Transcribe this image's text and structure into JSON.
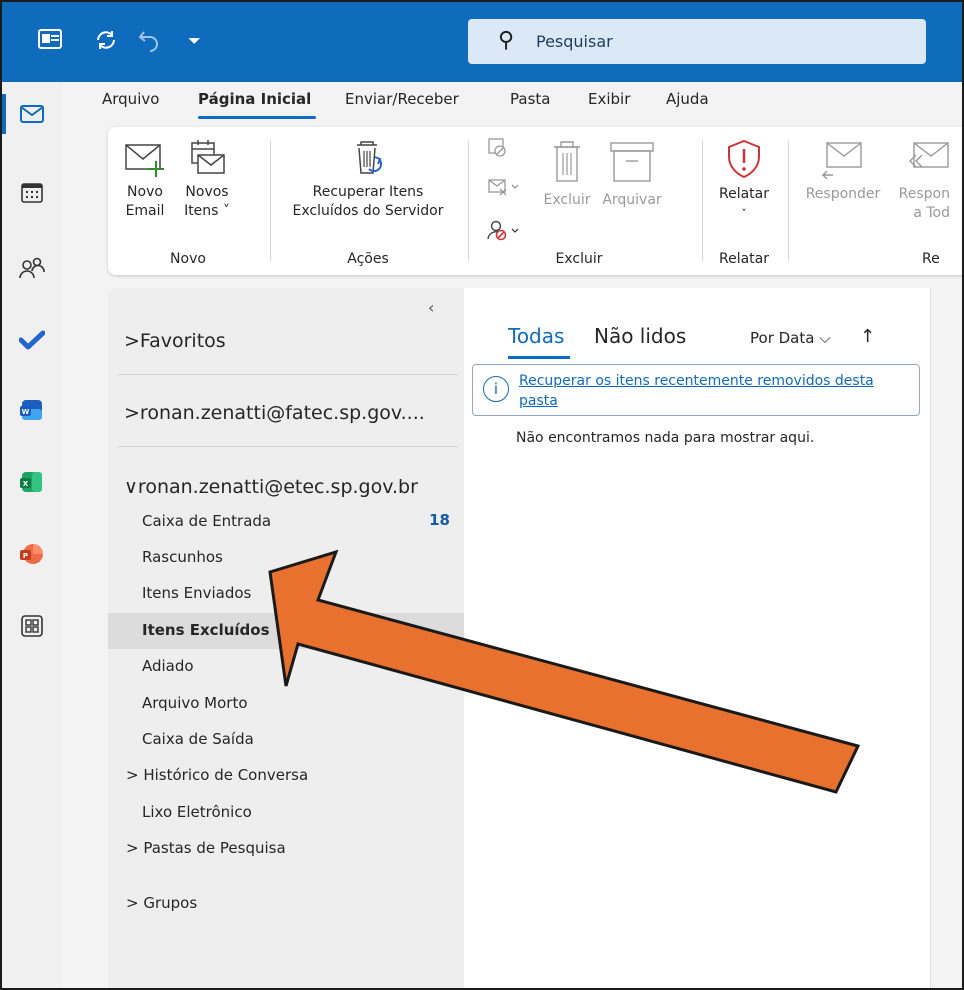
{
  "titlebar": {
    "search_placeholder": "Pesquisar"
  },
  "menu_tabs": [
    "Arquivo",
    "Página Inicial",
    "Enviar/Receber",
    "Pasta",
    "Exibir",
    "Ajuda"
  ],
  "ribbon": {
    "new_email": [
      "Novo",
      "Email"
    ],
    "new_items": [
      "Novos",
      "Itens ˅"
    ],
    "recover": [
      "Recuperar Itens",
      "Excluídos do Servidor"
    ],
    "delete": "Excluir",
    "archive": "Arquivar",
    "report": "Relatar",
    "reply": "Responder",
    "reply_all": [
      "Respon",
      "a Tod"
    ],
    "groups": {
      "novo": "Novo",
      "acoes": "Ações",
      "excluir": "Excluir",
      "relatar": "Relatar",
      "re": "Re"
    }
  },
  "folders": {
    "favorites": "Favoritos",
    "account1": "ronan.zenatti@fatec.sp.gov....",
    "account2": "ronan.zenatti@etec.sp.gov.br",
    "items": [
      {
        "label": "Caixa de Entrada",
        "count": "18"
      },
      {
        "label": "Rascunhos"
      },
      {
        "label": "Itens Enviados"
      },
      {
        "label": "Itens Excluídos",
        "selected": true
      },
      {
        "label": "Adiado"
      },
      {
        "label": "Arquivo Morto"
      },
      {
        "label": "Caixa de Saída"
      },
      {
        "label": "Histórico de Conversa",
        "expandable": true
      },
      {
        "label": "Lixo Eletrônico"
      },
      {
        "label": "Pastas de Pesquisa",
        "expandable": true
      }
    ],
    "groups": "Grupos"
  },
  "message_list": {
    "tab_all": "Todas",
    "tab_unread": "Não lidos",
    "sort_label": "Por Data",
    "info_link": "Recuperar os itens recentemente removidos desta pasta",
    "empty_text": "Não encontramos nada para mostrar aqui."
  },
  "colors": {
    "brand_blue": "#0f6cbd",
    "annotation_arrow": "#e8712f",
    "report_red": "#d13438"
  },
  "icons": [
    "outlook-icon",
    "sync-icon",
    "undo-icon",
    "customize-icon",
    "search-icon",
    "mail-icon",
    "calendar-icon",
    "people-icon",
    "todo-icon",
    "word-icon",
    "excel-icon",
    "powerpoint-icon",
    "apps-icon",
    "info-icon"
  ]
}
